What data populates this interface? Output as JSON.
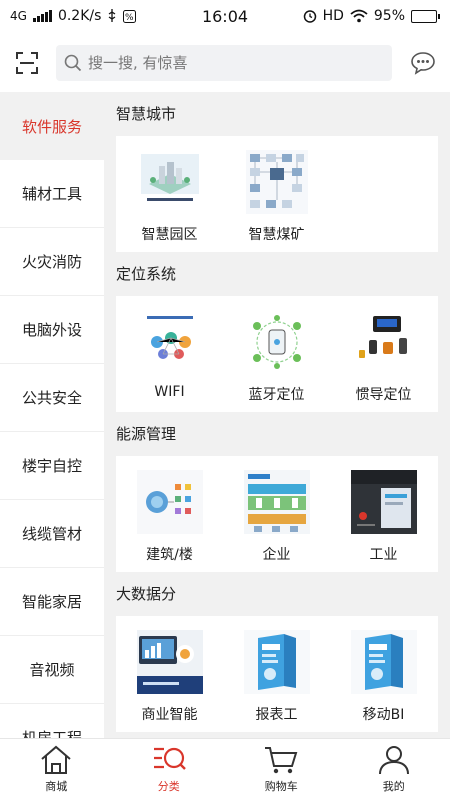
{
  "status_bar": {
    "network": "4G",
    "speed": "0.2K/s",
    "time": "16:04",
    "hd": "HD",
    "battery": "95%",
    "battery_level": 0.95
  },
  "search": {
    "placeholder": "搜一搜, 有惊喜"
  },
  "sidebar": {
    "items": [
      {
        "label": "软件服务",
        "active": true
      },
      {
        "label": "辅材工具"
      },
      {
        "label": "火灾消防"
      },
      {
        "label": "电脑外设"
      },
      {
        "label": "公共安全"
      },
      {
        "label": "楼宇自控"
      },
      {
        "label": "线缆管材"
      },
      {
        "label": "智能家居"
      },
      {
        "label": "音视频"
      },
      {
        "label": "机房工程"
      }
    ]
  },
  "sections": [
    {
      "title": "智慧城市",
      "items": [
        {
          "label": "智慧园区",
          "icon": "smart-park-image"
        },
        {
          "label": "智慧煤矿",
          "icon": "smart-coal-mine-image"
        }
      ]
    },
    {
      "title": "定位系统",
      "items": [
        {
          "label": "WIFI",
          "icon": "wifi-positioning-image"
        },
        {
          "label": "蓝牙定位",
          "icon": "bluetooth-positioning-image"
        },
        {
          "label": "惯导定位",
          "icon": "inertial-navigation-image"
        }
      ]
    },
    {
      "title": "能源管理",
      "items": [
        {
          "label": "建筑/楼",
          "icon": "building-energy-image"
        },
        {
          "label": "企业",
          "icon": "enterprise-energy-image"
        },
        {
          "label": "工业",
          "icon": "industrial-energy-image"
        }
      ]
    },
    {
      "title": "大数据分",
      "items": [
        {
          "label": "商业智能",
          "icon": "business-intelligence-image"
        },
        {
          "label": "报表工",
          "icon": "report-tool-image"
        },
        {
          "label": "移动BI",
          "icon": "mobile-bi-image"
        }
      ]
    }
  ],
  "tabbar": {
    "tabs": [
      {
        "label": "商城",
        "icon": "home-icon"
      },
      {
        "label": "分类",
        "icon": "category-icon",
        "active": true
      },
      {
        "label": "购物车",
        "icon": "cart-icon"
      },
      {
        "label": "我的",
        "icon": "user-icon"
      }
    ]
  },
  "colors": {
    "accent": "#d9362b",
    "background": "#f1f1f1"
  }
}
